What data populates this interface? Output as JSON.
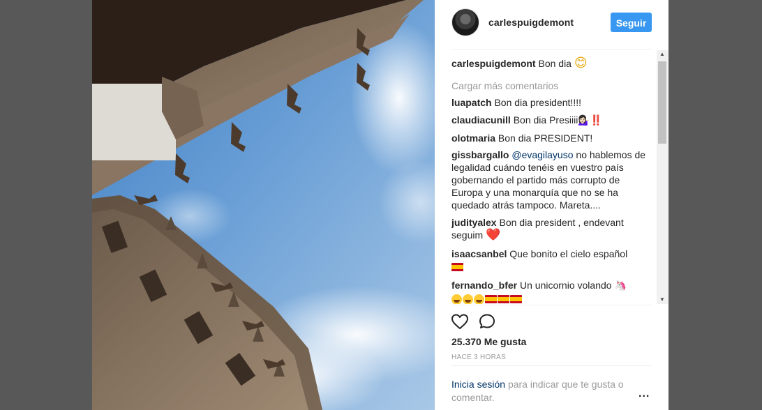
{
  "header": {
    "username": "carlespuigdemont",
    "follow_label": "Seguir"
  },
  "caption": {
    "username": "carlespuigdemont",
    "text": "Bon dia",
    "emoji": "😊"
  },
  "load_more": "Cargar más comentarios",
  "comments": [
    {
      "user": "luapatch",
      "text": "Bon dia president!!!!"
    },
    {
      "user": "claudiacunill",
      "text": "Bon dia Presiiii",
      "emoji": "💁🏻‍♀️‼️"
    },
    {
      "user": "olotmaria",
      "text": "Bon dia PRESIDENT!"
    },
    {
      "user": "gissbargallo",
      "mention": "@evagilayuso",
      "text": "no hablemos de legalidad cuándo tenéis en vuestro país gobernando el partido más corrupto de Europa y una monarquía que no se ha quedado atrás tampoco. Mareta...."
    },
    {
      "user": "judityalex",
      "text": "Bon dia president , endevant seguim",
      "emoji": "❤️"
    },
    {
      "user": "isaacsanbel",
      "text": "Que bonito el cielo español",
      "emoji": "🇪🇸"
    },
    {
      "user": "fernando_bfer",
      "text": "Un unicornio volando",
      "emoji": "🦄",
      "emoji_line": "😂😂😂🇪🇸🇪🇸🇪🇸💪🏻"
    }
  ],
  "actions": {
    "like_icon": "heart-outline-icon",
    "comment_icon": "speech-bubble-icon"
  },
  "likes": "25.370 Me gusta",
  "time": "HACE 3 HORAS",
  "login": {
    "link": "Inicia sesión",
    "text": "para indicar que te gusta o comentar."
  },
  "more": "...",
  "colors": {
    "follow_button": "#3897f0",
    "mention": "#003569",
    "muted": "#999999",
    "backdrop": "#585858"
  }
}
